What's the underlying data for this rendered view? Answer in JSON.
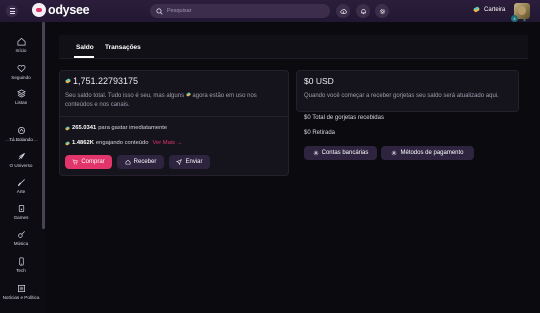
{
  "header": {
    "logo_text": "odysee",
    "search_placeholder": "Pesquisar",
    "wallet_label": "Carteira",
    "badge_count": "4",
    "close": "×"
  },
  "sidebar": {
    "items": [
      {
        "label": "Início",
        "icon": "home-icon"
      },
      {
        "label": "Seguindo",
        "icon": "heart-icon"
      },
      {
        "label": "Listas",
        "icon": "layers-icon"
      },
      {
        "label": "Tá Bolando",
        "icon": "trending-icon"
      },
      {
        "label": "O Universo",
        "icon": "rocket-icon"
      },
      {
        "label": "Arte",
        "icon": "brush-icon"
      },
      {
        "label": "Games",
        "icon": "gamepad-icon"
      },
      {
        "label": "Música",
        "icon": "guitar-icon"
      },
      {
        "label": "Tech",
        "icon": "phone-icon"
      },
      {
        "label": "Notícias e Política",
        "icon": "news-icon"
      }
    ]
  },
  "tabs": [
    {
      "label": "Saldo",
      "active": true
    },
    {
      "label": "Transações",
      "active": false
    }
  ],
  "balance_card": {
    "total": "1,751.22793175",
    "description_1": "Seu saldo total. Tudo isso é seu, mas alguns",
    "description_1b": "agora estão em uso nos",
    "description_2": "conteúdos e nos canais.",
    "spend_amount": "265.0341",
    "spend_label": "para gastar imediatamente",
    "engaged_amount": "1.4862K",
    "engaged_label": "engajando conteúdo",
    "see_more": "Ver Mais →",
    "buttons": {
      "buy": "Comprar",
      "receive": "Receber",
      "send": "Enviar"
    }
  },
  "usd_card": {
    "total": "$0 USD",
    "description": "Quando você começar a receber gorjetas seu saldo será atualizado aqui.",
    "tips_received": "$0 Total de gorjetas recebidas",
    "withdrawn": "$0 Retirada",
    "buttons": {
      "bank_accounts": "Contas bancárias",
      "payment_methods": "Métodos de pagamento"
    }
  },
  "colors": {
    "accent": "#e1356b",
    "header_bg": "#2b1d3b",
    "lbc_gold": "#f3b74c",
    "lbc_teal": "#4fd1c5"
  }
}
